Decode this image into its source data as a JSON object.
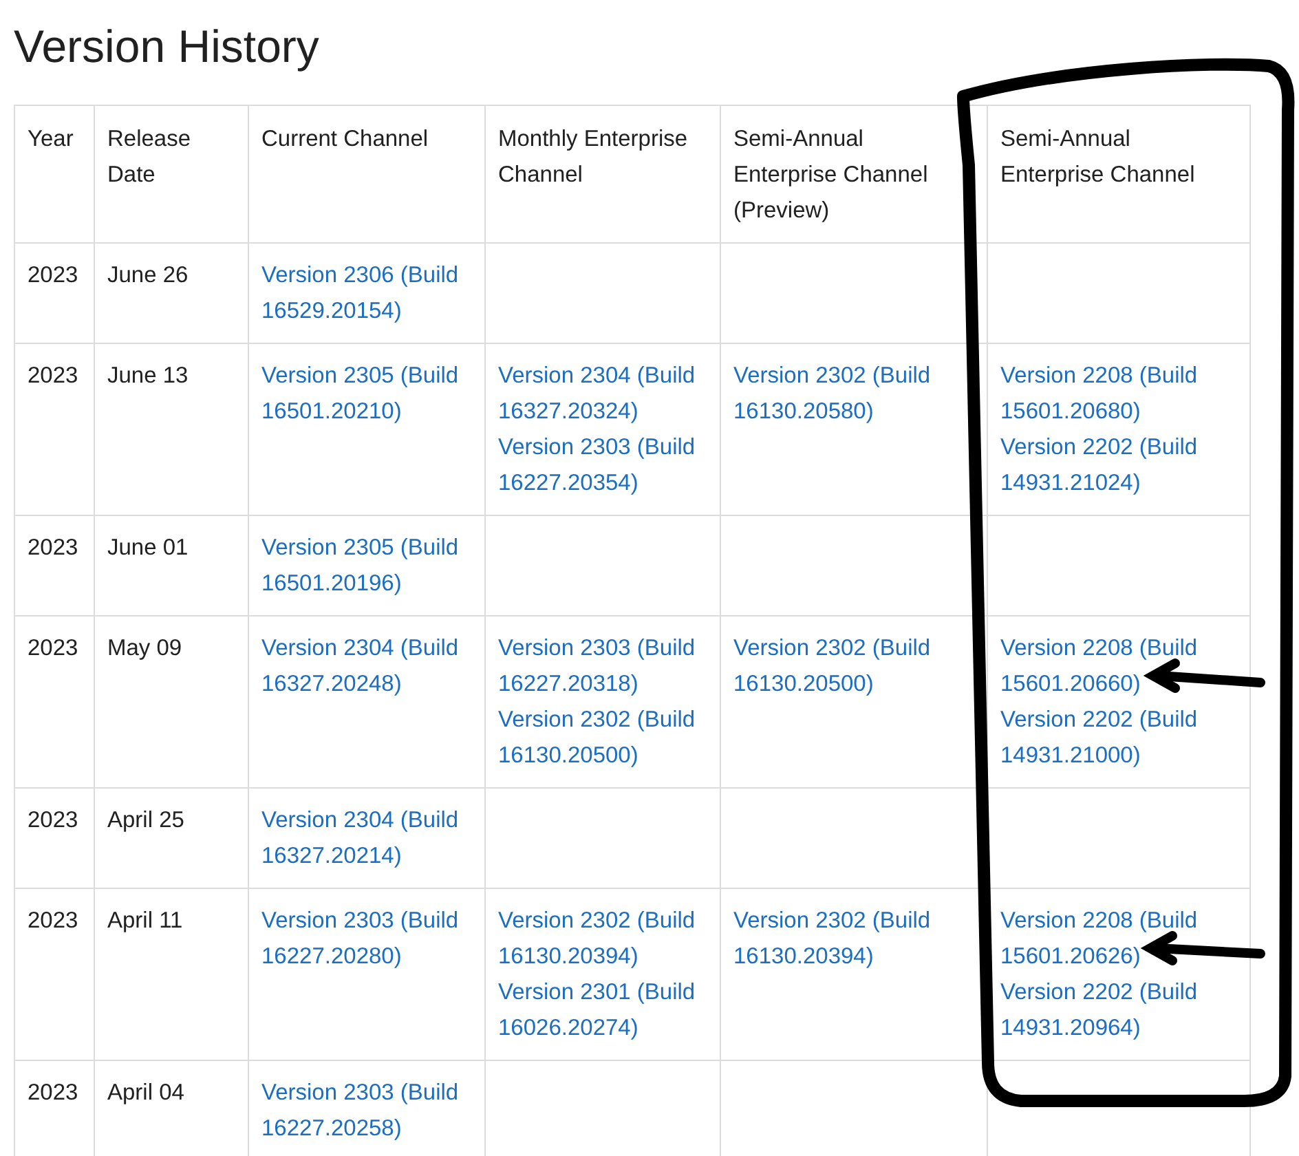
{
  "title": "Version History",
  "table": {
    "columns": [
      "Year",
      "Release Date",
      "Current Channel",
      "Monthly Enterprise Channel",
      "Semi-Annual Enterprise Channel (Preview)",
      "Semi-Annual Enterprise Channel"
    ],
    "rows": [
      {
        "year": "2023",
        "release_date": "June 26",
        "channels": [
          [
            "Version 2306 (Build 16529.20154)"
          ]
        ]
      },
      {
        "year": "2023",
        "release_date": "June 13",
        "channels": [
          [
            "Version 2305 (Build 16501.20210)"
          ],
          [
            "Version 2304 (Build 16327.20324)",
            "Version 2303 (Build 16227.20354)"
          ],
          [
            "Version 2302 (Build 16130.20580)"
          ],
          [
            "Version 2208 (Build 15601.20680)",
            "Version 2202 (Build 14931.21024)"
          ]
        ]
      },
      {
        "year": "2023",
        "release_date": "June 01",
        "channels": [
          [
            "Version 2305 (Build 16501.20196)"
          ]
        ]
      },
      {
        "year": "2023",
        "release_date": "May 09",
        "channels": [
          [
            "Version 2304 (Build 16327.20248)"
          ],
          [
            "Version 2303 (Build 16227.20318)",
            "Version 2302 (Build 16130.20500)"
          ],
          [
            "Version 2302 (Build 16130.20500)"
          ],
          [
            "Version 2208 (Build 15601.20660)",
            "Version 2202 (Build 14931.21000)"
          ]
        ]
      },
      {
        "year": "2023",
        "release_date": "April 25",
        "channels": [
          [
            "Version 2304 (Build 16327.20214)"
          ]
        ]
      },
      {
        "year": "2023",
        "release_date": "April 11",
        "channels": [
          [
            "Version 2303 (Build 16227.20280)"
          ],
          [
            "Version 2302 (Build 16130.20394)",
            "Version 2301 (Build 16026.20274)"
          ],
          [
            "Version 2302 (Build 16130.20394)"
          ],
          [
            "Version 2208 (Build 15601.20626)",
            "Version 2202 (Build 14931.20964)"
          ]
        ]
      },
      {
        "year": "2023",
        "release_date": "April 04",
        "channels": [
          [
            "Version 2303 (Build 16227.20258)"
          ]
        ]
      }
    ]
  }
}
